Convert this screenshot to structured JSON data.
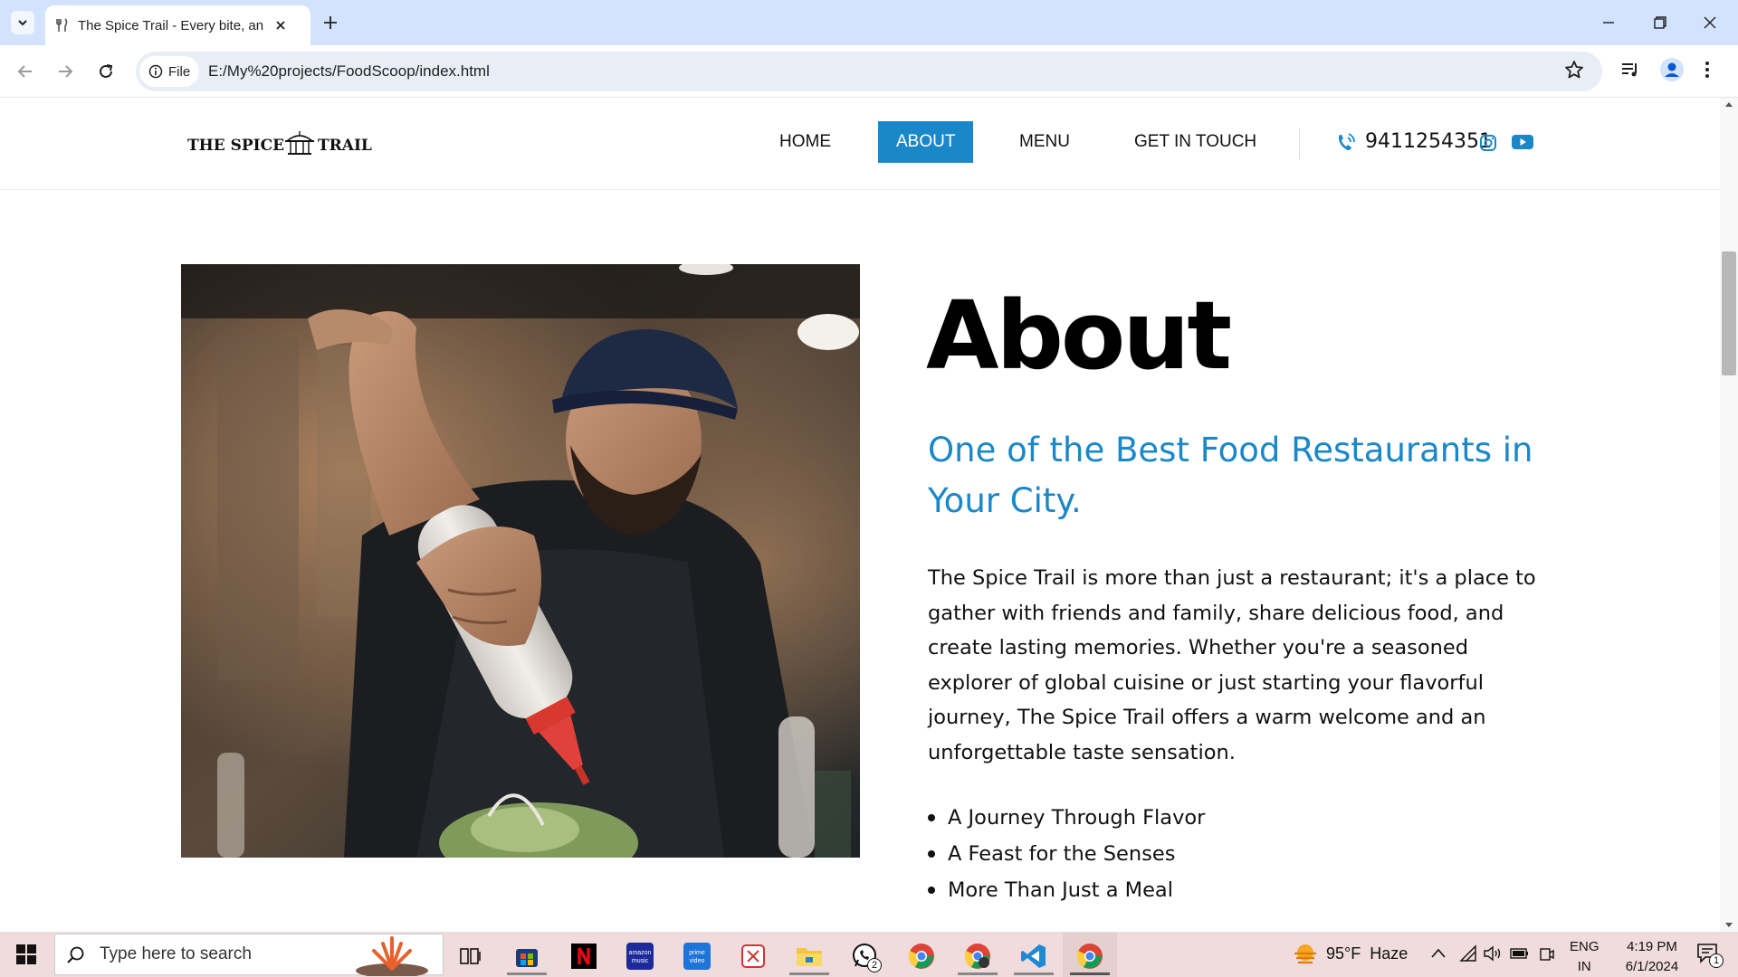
{
  "browser": {
    "tab_title": "The Spice Trail - Every bite, an a",
    "url": "E:/My%20projects/FoodScoop/index.html",
    "file_chip": "File"
  },
  "site": {
    "nav": {
      "home": "HOME",
      "about": "ABOUT",
      "menu": "MENU",
      "contact": "GET IN TOUCH",
      "active": "ABOUT"
    },
    "phone": "9411254351",
    "accent_color": "#1a87c9",
    "logo_alt": "THE SPICE TRAIL"
  },
  "about": {
    "title": "About",
    "subtitle": "One of the Best Food Restaurants in Your City.",
    "body": "The Spice Trail is more than just a restaurant; it's a place to gather with friends and family, share delicious food, and create lasting memories. Whether you're a seasoned explorer of global cuisine or just starting your flavorful journey, The Spice Trail offers a warm welcome and an unforgettable taste sensation.",
    "list": [
      "A Journey Through Flavor",
      "A Feast for the Senses",
      "More Than Just a Meal"
    ]
  },
  "taskbar": {
    "search_placeholder": "Type here to search",
    "weather": "95°F  Haze",
    "lang_line1": "ENG",
    "lang_line2": "IN",
    "time": "4:19 PM",
    "date": "6/1/2024",
    "whatsapp_badge": "2",
    "notifications_badge": "1"
  }
}
